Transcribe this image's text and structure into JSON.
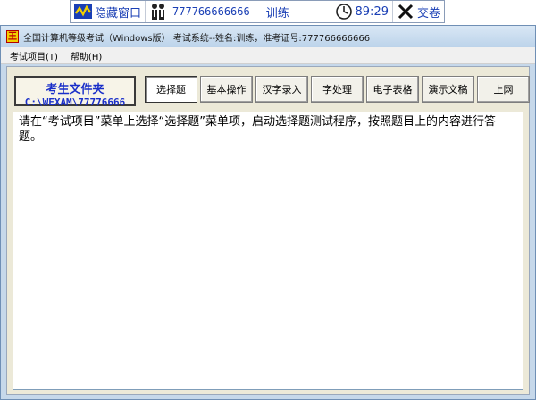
{
  "status_bar": {
    "hide_window_label": "隐藏窗口",
    "candidate_id": "777766666666",
    "mode": "训练",
    "timer": "89:29",
    "submit_label": "交卷",
    "icons": [
      "logo-wave-icon",
      "people-icon",
      "clock-icon",
      "close-x-icon"
    ]
  },
  "window": {
    "title": "全国计算机等级考试（Windows版） 考试系统--姓名:训练，准考证号:777766666666",
    "app_icon_letter": "王",
    "menu": [
      "考试项目(T)",
      "帮助(H)"
    ]
  },
  "folder": {
    "title": "考生文件夹",
    "path": "C:\\WEXAM\\77776666"
  },
  "tabs": [
    {
      "label": "选择题",
      "active": true
    },
    {
      "label": "基本操作",
      "active": false
    },
    {
      "label": "汉字录入",
      "active": false
    },
    {
      "label": "字处理",
      "active": false
    },
    {
      "label": "电子表格",
      "active": false
    },
    {
      "label": "演示文稿",
      "active": false
    },
    {
      "label": "上网",
      "active": false
    }
  ],
  "instructions": "请在“考试项目”菜单上选择“选择题”菜单项，启动选择题测试程序，按照题目上的内容进行答题。",
  "colors": {
    "accent_blue": "#1a3fb5",
    "panel_bg": "#ece9d8",
    "window_border": "#6f8fb5"
  }
}
